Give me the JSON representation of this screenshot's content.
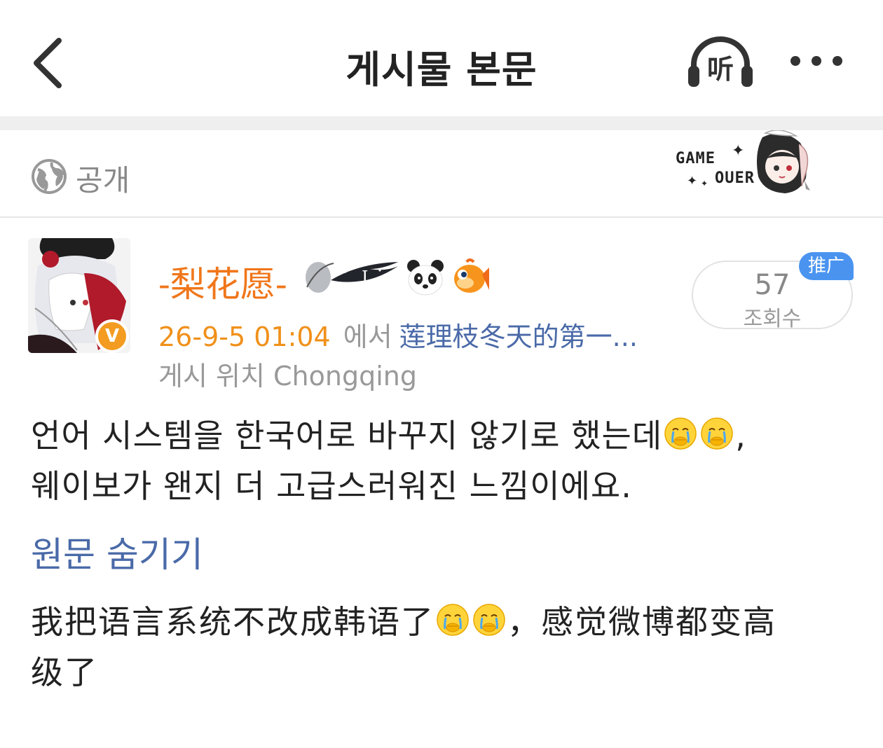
{
  "header": {
    "title": "게시물 본문",
    "listen_label": "听"
  },
  "visibility": {
    "label": "공개",
    "sticker_line1": "GAME",
    "sticker_line2": "OUER"
  },
  "author": {
    "name": "-梨花愿-",
    "verified_mark": "V",
    "badge_icons": [
      "wing-badge-icon",
      "panda-icon",
      "fish-icon"
    ]
  },
  "post_meta": {
    "time": "26-9-5 01:04",
    "from_label": "에서",
    "source": "莲理枝冬天的第一...",
    "location": "게시 위치 Chongqing"
  },
  "views": {
    "count": "57",
    "label": "조회수",
    "promo_tag": "推广"
  },
  "post": {
    "translated_part1": "언어 시스템을 한국어로 바꾸지 않기로 했는데",
    "translated_part2": ",",
    "translated_part3": "웨이보가 왠지 더 고급스러워진 느낌이에요.",
    "hide_original_label": "원문 숨기기",
    "original_part1": "我把语言系统不改成韩语了",
    "original_part2": "，感觉微博都变高级了",
    "emoji_name": "crying-emoji"
  },
  "colors": {
    "accent_orange": "#f0761a",
    "link_blue": "#4a6aa8",
    "verified": "#f39c21",
    "promo": "#4a94f0"
  }
}
